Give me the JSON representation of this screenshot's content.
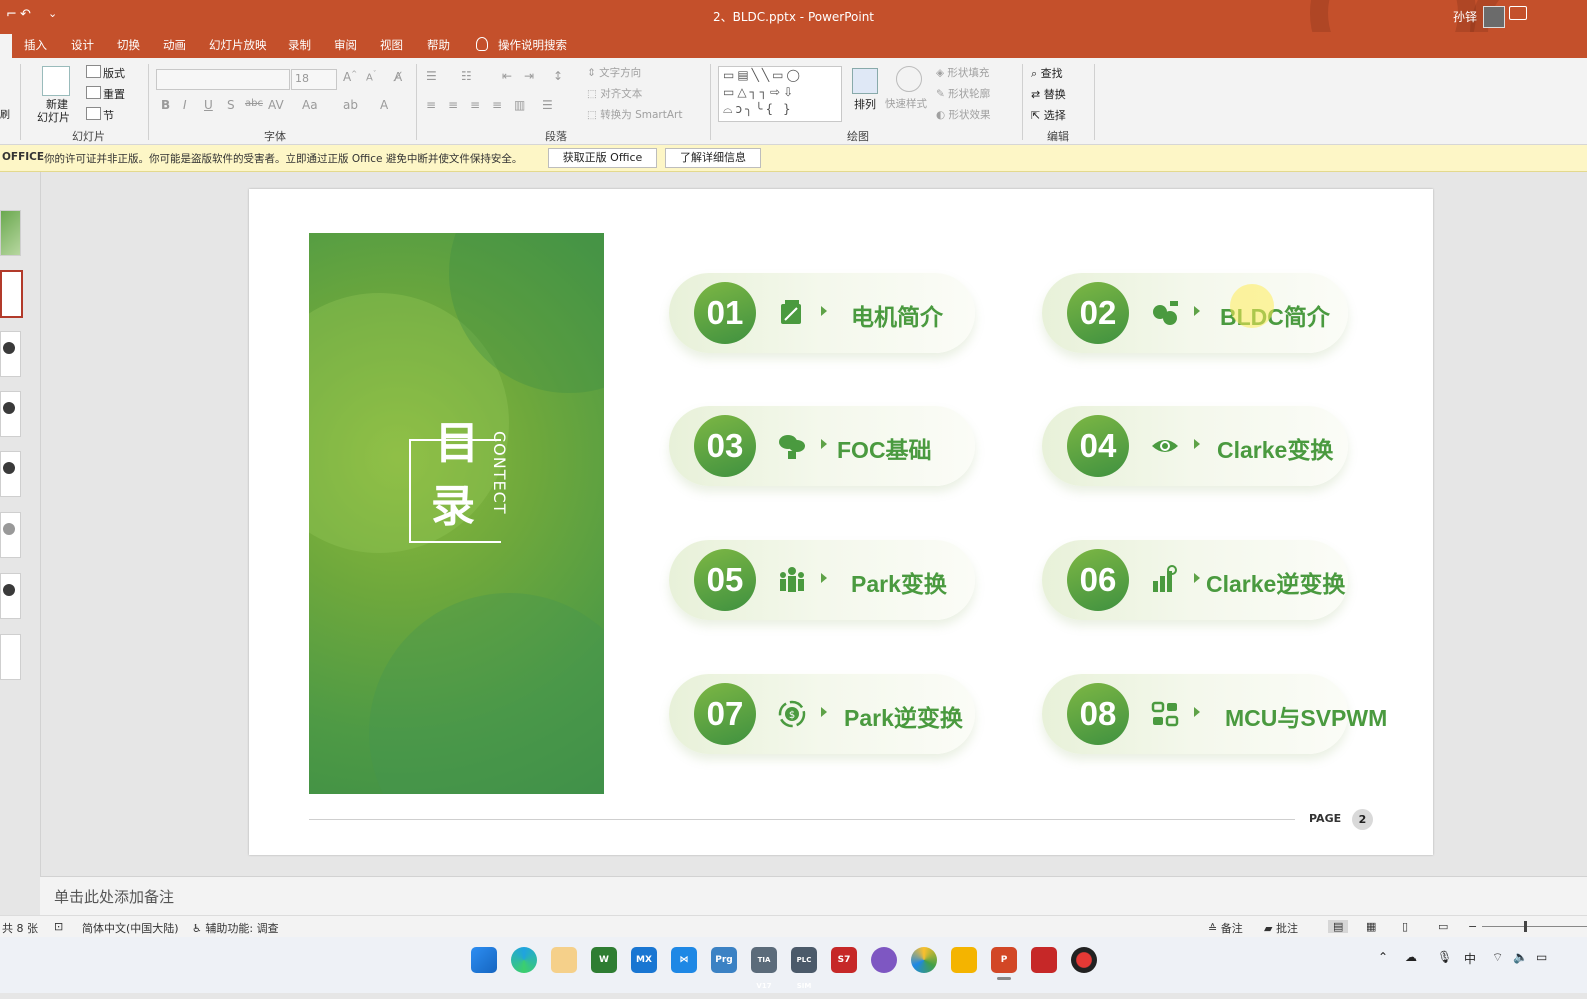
{
  "window": {
    "title": "2、BLDC.pptx  -  PowerPoint",
    "user_name": "孙铎",
    "qat_undo": "↶",
    "qat_more": "⌄"
  },
  "tabs": [
    "插入",
    "设计",
    "切换",
    "动画",
    "幻灯片放映",
    "录制",
    "审阅",
    "视图",
    "帮助"
  ],
  "tell_me": "操作说明搜索",
  "ribbon": {
    "slides": {
      "new_slide": "新建",
      "new_slide2": "幻灯片",
      "layout": "版式",
      "reset": "重置",
      "section": "节",
      "group": "幻灯片"
    },
    "font": {
      "size": "18",
      "group": "字体"
    },
    "paragraph": {
      "text_direction": "文字方向",
      "align_text": "对齐文本",
      "smartart": "转换为 SmartArt",
      "group": "段落"
    },
    "drawing": {
      "arrange": "排列",
      "quick_styles": "快速样式",
      "fill": "形状填充",
      "outline": "形状轮廓",
      "effects": "形状效果",
      "group": "绘图"
    },
    "editing": {
      "find": "查找",
      "replace": "替换",
      "select": "选择",
      "group": "编辑"
    }
  },
  "notification": {
    "brand": "OFFICE",
    "message": "你的许可证并非正版。你可能是盗版软件的受害者。立即通过正版 Office 避免中断并使文件保持安全。",
    "button_genuine": "获取正版 Office",
    "button_learn": "了解详细信息"
  },
  "slide": {
    "title_chars": [
      "目",
      "录"
    ],
    "side_text": "CONTECT",
    "items": [
      {
        "num": "01",
        "label": "电机简介",
        "icon": "monitor-icon"
      },
      {
        "num": "02",
        "label": "BLDC简介",
        "icon": "people-chart-icon"
      },
      {
        "num": "03",
        "label": "FOC基础",
        "icon": "chat-bubbles-icon"
      },
      {
        "num": "04",
        "label": "Clarke变换",
        "icon": "eye-icon"
      },
      {
        "num": "05",
        "label": "Park变换",
        "icon": "team-icon"
      },
      {
        "num": "06",
        "label": "Clarke逆变换",
        "icon": "bar-chart-icon"
      },
      {
        "num": "07",
        "label": "Park逆变换",
        "icon": "money-cycle-icon"
      },
      {
        "num": "08",
        "label": "MCU与SVPWM",
        "icon": "flowchart-icon"
      }
    ],
    "page_label": "PAGE",
    "page_num": "2"
  },
  "notes_placeholder": "单击此处添加备注",
  "status": {
    "slide_count": "共 8 张",
    "language": "简体中文(中国大陆)",
    "accessibility": "辅助功能: 调查",
    "notes": "备注",
    "comments": "批注"
  },
  "taskbar": {
    "apps": [
      "windows-start",
      "edge",
      "notepad",
      "word",
      "mx",
      "vscode",
      "prg",
      "tia",
      "plcsim",
      "s7",
      "ball",
      "chrome-like",
      "files",
      "powerpoint",
      "acrobat",
      "recorder"
    ],
    "labels": {
      "mx": "MX",
      "prg": "Prg",
      "tia": "TIA V17",
      "plcsim": "PLC SIM",
      "s7": "S7"
    },
    "ime": "中"
  }
}
